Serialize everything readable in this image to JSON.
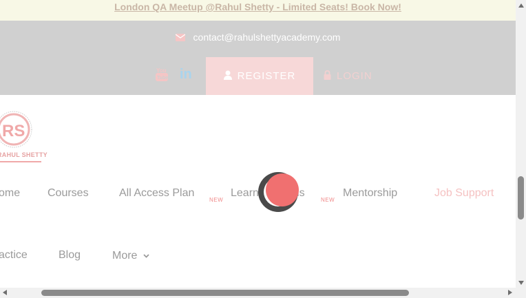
{
  "announcement": {
    "text": "London QA Meetup @Rahul Shetty - Limited Seats! Book Now!"
  },
  "topbar": {
    "email": "contact@rahulshettyacademy.com",
    "register_label": "REGISTER",
    "login_label": "LOGIN",
    "social": [
      "youtube-icon",
      "linkedin-icon"
    ]
  },
  "logo": {
    "text": "RAHUL SHETTY"
  },
  "nav": {
    "row1": [
      {
        "label": "ome"
      },
      {
        "label": "Courses"
      },
      {
        "label": "All Access Plan",
        "badge": "NEW"
      },
      {
        "label": "Learning Paths",
        "badge": "NEW"
      },
      {
        "label": "Mentorship"
      },
      {
        "label": "Job Support"
      }
    ],
    "row2": [
      {
        "label": "actice"
      },
      {
        "label": "Blog"
      },
      {
        "label": "More"
      }
    ]
  },
  "colors": {
    "accent": "#f08a8a",
    "topbar_bg": "#d0d0d0",
    "announcement_bg": "#f8f8e6",
    "spinner_dark": "#4a4a4a",
    "spinner_red": "#f07070"
  }
}
